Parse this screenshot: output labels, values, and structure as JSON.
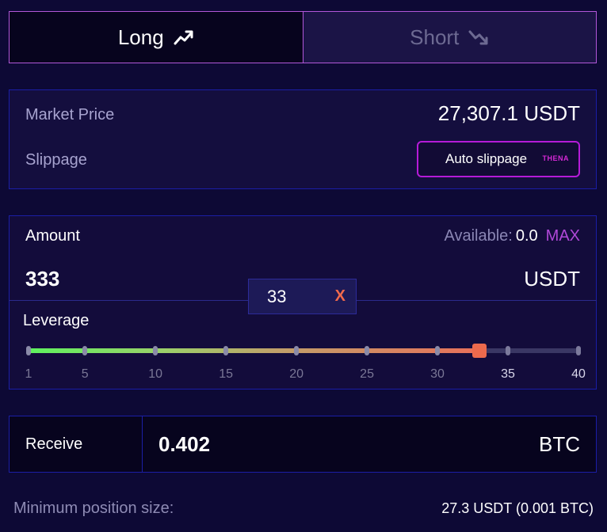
{
  "tabs": {
    "long_label": "Long",
    "short_label": "Short"
  },
  "market": {
    "price_label": "Market Price",
    "price_value": "27,307.1 USDT",
    "slippage_label": "Slippage",
    "slippage_button": "Auto slippage",
    "slippage_logo": "THENA"
  },
  "amount": {
    "label": "Amount",
    "available_label": "Available:",
    "available_value": "0.0",
    "max_label": "MAX",
    "value": "333",
    "unit": "USDT"
  },
  "leverage": {
    "label": "Leverage",
    "value": "33",
    "clear_label": "X",
    "min": 1,
    "max": 40,
    "ticks": [
      "1",
      "5",
      "10",
      "15",
      "20",
      "25",
      "30",
      "35",
      "40"
    ]
  },
  "receive": {
    "label": "Receive",
    "value": "0.402",
    "unit": "BTC"
  },
  "min_position": {
    "label": "Minimum position size:",
    "value": "27.3 USDT (0.001 BTC)"
  },
  "colors": {
    "accent": "#b257d9",
    "slider_thumb": "#ec6a4d",
    "max_link": "#b048d8"
  }
}
